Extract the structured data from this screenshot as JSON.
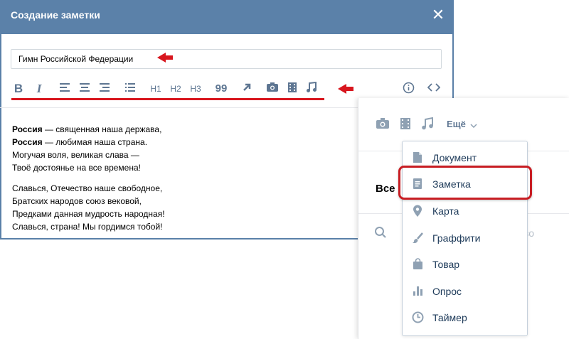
{
  "modal": {
    "title": "Создание заметки",
    "close_icon": "✕",
    "title_input_value": "Гимн Российской Федерации"
  },
  "toolbar": {
    "bold": "B",
    "italic": "I",
    "h1": "H1",
    "h2": "H2",
    "h3": "H3",
    "quote": "99",
    "icons": [
      "bold-icon",
      "italic-icon",
      "align-left-icon",
      "align-center-icon",
      "align-right-icon",
      "list-icon",
      "h1-icon",
      "h2-icon",
      "h3-icon",
      "quote-icon",
      "link-icon",
      "camera-icon",
      "video-icon",
      "music-icon",
      "info-icon",
      "code-icon"
    ]
  },
  "poem": {
    "stanza1": [
      {
        "bold": "Россия",
        "rest": " — священная наша держава,"
      },
      {
        "bold": "Россия",
        "rest": " — любимая наша страна."
      },
      {
        "bold": "",
        "rest": "Могучая воля, великая слава —"
      },
      {
        "bold": "",
        "rest": "Твоё достоянье на все времена!"
      }
    ],
    "stanza2": [
      "Славься, Отечество наше свободное,",
      "Братских народов союз вековой,",
      "Предками данная мудрость народная!",
      "Славься, страна! Мы гордимся тобой!"
    ]
  },
  "panel": {
    "more_label": "Ещё",
    "all_label": "Все",
    "faded_text": "во"
  },
  "dropdown": {
    "items": [
      {
        "label": "Документ",
        "icon": "document-icon"
      },
      {
        "label": "Заметка",
        "icon": "note-icon"
      },
      {
        "label": "Карта",
        "icon": "map-pin-icon"
      },
      {
        "label": "Граффити",
        "icon": "brush-icon"
      },
      {
        "label": "Товар",
        "icon": "shopping-bag-icon"
      },
      {
        "label": "Опрос",
        "icon": "poll-icon"
      },
      {
        "label": "Таймер",
        "icon": "timer-icon"
      }
    ]
  },
  "colors": {
    "header": "#5b81a9",
    "accent_red": "#d8161e",
    "icon_gray": "#8fa1b3",
    "link_blue": "#1d3a59"
  }
}
